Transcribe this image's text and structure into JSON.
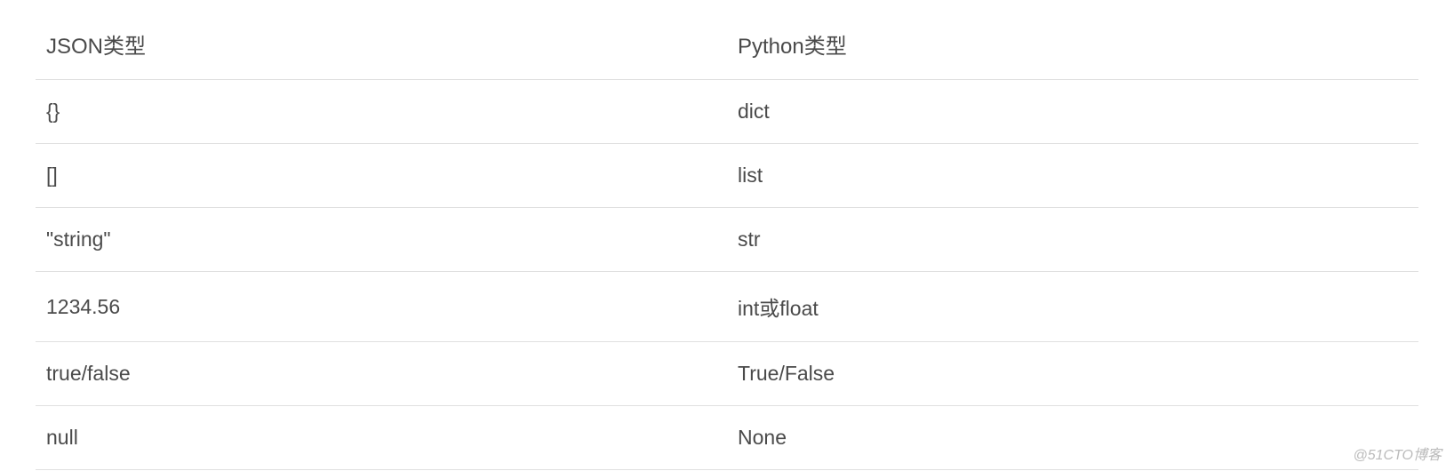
{
  "table": {
    "headers": {
      "json": "JSON类型",
      "python": "Python类型"
    },
    "rows": [
      {
        "json": "{}",
        "python": "dict"
      },
      {
        "json": "[]",
        "python": "list"
      },
      {
        "json": "\"string\"",
        "python": "str"
      },
      {
        "json": "1234.56",
        "python": "int或float"
      },
      {
        "json": "true/false",
        "python": "True/False"
      },
      {
        "json": "null",
        "python": "None"
      }
    ]
  },
  "watermark": "@51CTO博客"
}
